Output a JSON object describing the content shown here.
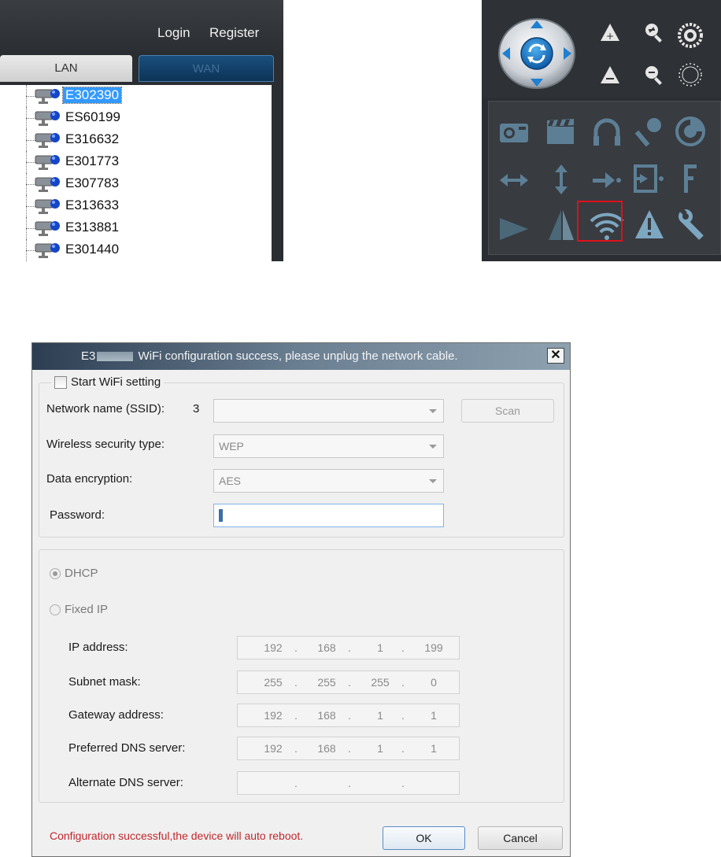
{
  "device_panel": {
    "header": {
      "login": "Login",
      "register": "Register"
    },
    "tabs": [
      {
        "label": "LAN",
        "active": true
      },
      {
        "label": "WAN",
        "active": false
      }
    ],
    "devices": [
      "E302390",
      "ES60199",
      "E316632",
      "E301773",
      "E307783",
      "E313633",
      "E313881",
      "E301440"
    ],
    "selected_index": 0
  },
  "ptz_panel": {
    "direction_pad_icon": "ptz-direction-pad-icon",
    "zoom_icons": [
      "zoom-in-icon",
      "zoom-out-icon",
      "focus-near-icon",
      "focus-far-icon",
      "iris-open-icon",
      "iris-close-icon"
    ],
    "tool_icons": [
      [
        "snapshot-icon",
        "record-icon",
        "listen-icon",
        "talk-icon",
        "dial-icon"
      ],
      [
        "horizontal-cruise-icon",
        "vertical-cruise-icon",
        "preset-goto-icon",
        "input-icon",
        "font-icon"
      ],
      [
        "mirror-icon",
        "flip-icon",
        "wifi-icon",
        "alarm-icon",
        "settings-icon"
      ]
    ],
    "highlighted": "wifi-icon",
    "highlight_color": "#e0101a"
  },
  "dialog": {
    "title_prefix": "E3",
    "title_suffix": "WiFi configuration success, please unplug the network cable.",
    "close_label": "✕",
    "wifi": {
      "start_label": "Start WiFi setting",
      "start_checked": false,
      "ssid_label": "Network name (SSID):",
      "ssid_count": "3",
      "ssid_value": "",
      "scan_label": "Scan",
      "security_label": "Wireless security type:",
      "security_value": "WEP",
      "encryption_label": "Data encryption:",
      "encryption_value": "AES",
      "password_label": "Password:",
      "password_value": ""
    },
    "ip": {
      "dhcp_label": "DHCP",
      "dhcp_selected": true,
      "fixed_label": "Fixed IP",
      "fields": [
        {
          "label": "IP address:",
          "octets": [
            "192",
            "168",
            "1",
            "199"
          ]
        },
        {
          "label": "Subnet mask:",
          "octets": [
            "255",
            "255",
            "255",
            "0"
          ]
        },
        {
          "label": "Gateway address:",
          "octets": [
            "192",
            "168",
            "1",
            "1"
          ]
        },
        {
          "label": "Preferred DNS server:",
          "octets": [
            "192",
            "168",
            "1",
            "1"
          ]
        },
        {
          "label": "Alternate DNS server:",
          "octets": [
            "",
            "",
            "",
            ""
          ]
        }
      ]
    },
    "status": "Configuration successful,the device will auto reboot.",
    "ok_label": "OK",
    "cancel_label": "Cancel",
    "status_color": "#c0272d"
  }
}
